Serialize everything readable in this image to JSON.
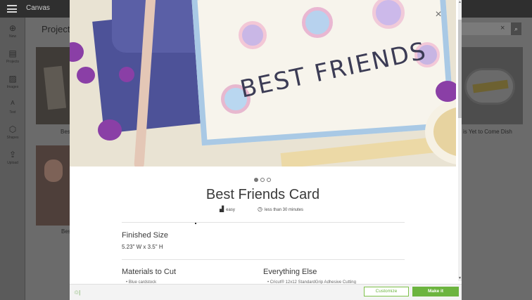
{
  "app": {
    "title": "Canvas"
  },
  "nav": {
    "items": [
      {
        "icon": "plus-circle-icon",
        "glyph": "⊕",
        "label": "New"
      },
      {
        "icon": "projects-icon",
        "glyph": "▤",
        "label": "Projects"
      },
      {
        "icon": "images-icon",
        "glyph": "▨",
        "label": "Images"
      },
      {
        "icon": "text-icon",
        "glyph": "ᴬ",
        "label": "Text"
      },
      {
        "icon": "shapes-icon",
        "glyph": "⬡",
        "label": "Shapes"
      },
      {
        "icon": "upload-icon",
        "glyph": "⇪",
        "label": "Upload"
      }
    ]
  },
  "background": {
    "page_title": "Projects",
    "captions": {
      "left_top": "Best",
      "left_bottom": "Bes",
      "right": "is Yet to Come Dish"
    }
  },
  "modal": {
    "close_glyph": "×",
    "carousel": {
      "count": 3,
      "active": 0
    },
    "title": "Best Friends Card",
    "difficulty": "easy",
    "time": "less than 30 minutes",
    "finished_size_label": "Finished Size",
    "finished_size_value": "5.23\" W x 3.5\" H",
    "materials_label": "Materials to Cut",
    "materials_first": "• Blue cardstock",
    "everything_else_label": "Everything Else",
    "everything_else_first": "• Cricut® 12x12 StandardGrip Adhesive Cutting",
    "hero_text": "BEST FRIENDS",
    "buttons": {
      "customize": "Customize",
      "make_it": "Make it"
    }
  },
  "colors": {
    "accent_green": "#6cb43f",
    "topbar": "#2f2f2f",
    "card_border": "#a9c9e5",
    "envelope": "#4d5298"
  }
}
